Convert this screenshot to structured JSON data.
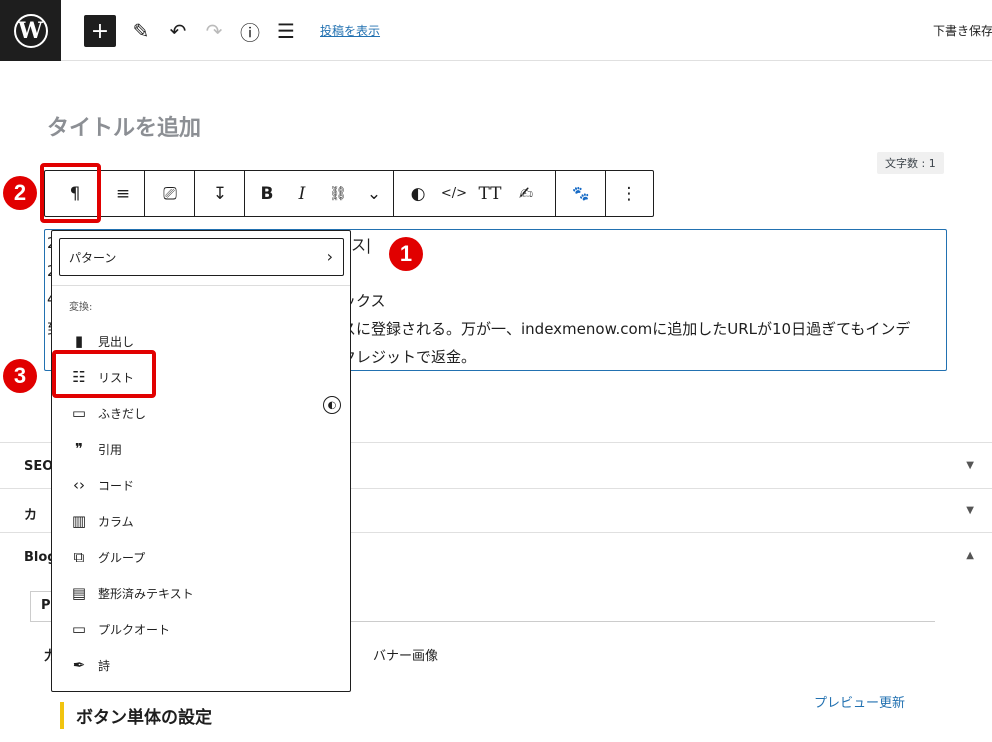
{
  "topbar": {
    "logo_text": "W",
    "add_icon": "+",
    "pen_icon": "✎",
    "undo_icon": "↶",
    "redo_icon": "↷",
    "info_icon": "ⓘ",
    "outline_icon": "☰",
    "view_post": "投稿を表示",
    "save_draft": "下書き保存"
  },
  "editor": {
    "title_placeholder": "タイトルを追加",
    "char_count": "文字数 : 1",
    "paragraph_lines": [
      "2",
      "2",
      "4",
      "到"
    ],
    "paragraph_right": [
      "ス|",
      "ックス",
      "スに登録される。万が一、indexmenow.comに追加したURLが10日過ぎてもインデ",
      "クレジットで返金。"
    ]
  },
  "block_toolbar": {
    "paragraph_icon": "¶",
    "align_icon": "≡",
    "device_icon": "⎚",
    "margin_icon": "↧",
    "bold": "B",
    "italic": "I",
    "link_icon": "⛓",
    "more_icon": "⌄",
    "swell_icon": "◐",
    "code_icon": "</>",
    "text_size_icon": "TT",
    "highlight_icon": "✍",
    "paw_icon": "🐾",
    "options_icon": "⋮"
  },
  "dropdown": {
    "pattern_label": "パターン",
    "pattern_chevron": "›",
    "transform_heading": "変換:",
    "items": [
      {
        "icon": "▮",
        "label": "見出し"
      },
      {
        "icon": "☷",
        "label": "リスト"
      },
      {
        "icon": "▭",
        "label": "ふきだし"
      },
      {
        "icon": "❞",
        "label": "引用"
      },
      {
        "icon": "‹›",
        "label": "コード"
      },
      {
        "icon": "▥",
        "label": "カラム"
      },
      {
        "icon": "⧉",
        "label": "グループ"
      },
      {
        "icon": "▤",
        "label": "整形済みテキスト"
      },
      {
        "icon": "▭",
        "label": "プルクオート"
      },
      {
        "icon": "✒",
        "label": "詩"
      }
    ],
    "swell_check": "◐"
  },
  "markers": {
    "one": "1",
    "two": "2",
    "three": "3"
  },
  "panels": {
    "seo": "SEO",
    "seo_arrow": "▼",
    "ka": "カ",
    "ka_arrow": "▼",
    "blog": "Blog",
    "blog_arrow": "▲",
    "tab": "P",
    "small_label": "力",
    "banner": "バナー画像",
    "preview_update": "プレビュー更新",
    "section_heading": "ボタン単体の設定"
  }
}
